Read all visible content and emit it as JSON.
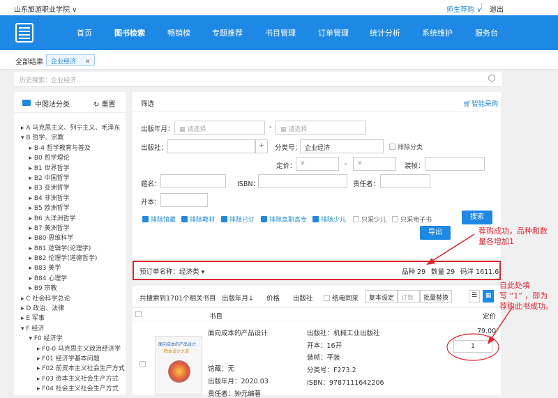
{
  "topbar": {
    "school": "山东旅游职业学院 ∨",
    "user": "师生荐购 ∨",
    "logout": "退出"
  },
  "nav": {
    "items": [
      "首页",
      "图书检索",
      "畅销榜",
      "专题推荐",
      "书目管理",
      "订单管理",
      "统计分析",
      "系统维护",
      "服务台"
    ],
    "active_index": 1
  },
  "breadcrumb": {
    "all": "全部结果 >",
    "tag": "企业经济",
    "tag_close": "✕"
  },
  "search": {
    "placeholder": "历史搜索：企业经济"
  },
  "sidebar": {
    "title": "中图法分类",
    "reset": "重置",
    "tree": [
      "▸ A 马克思主义、列宁主义、毛泽东",
      "▾ B 哲学、宗教",
      "    ▸ B-4 哲学教育与普及",
      "    ▸ B0 哲学理论",
      "    ▸ B1 世界哲学",
      "    ▸ B2 中国哲学",
      "    ▸ B3 亚洲哲学",
      "    ▸ B4 非洲哲学",
      "    ▸ B5 欧洲哲学",
      "    ▸ B6 大洋洲哲学",
      "    ▸ B7 美洲哲学",
      "    ▸ B80 思维科学",
      "    ▸ B81 逻辑学(论理学)",
      "    ▸ B82 伦理学(道德哲学)",
      "    ▸ B83 美学",
      "    ▸ B84 心理学",
      "    ▸ B9 宗教",
      "▸ C 社会科学总论",
      "▸ D 政治、法律",
      "▸ E 军事",
      "▾ F 经济",
      "    ▾ F0 经济学",
      "        ▸ F0-0 马克思主义政治经济学",
      "        ▸ F01 经济学基本问题",
      "        ▸ F02 前资本主义社会生产方式",
      "        ▸ F03 资本主义社会生产方式",
      "        ▸ F04 社会主义社会生产方式"
    ]
  },
  "filter": {
    "title": "筛选",
    "smart": "智能采购",
    "pub_date_label": "出版年月：",
    "date_placeholder": "请选择",
    "dash": "-",
    "publisher_label": "出版社：",
    "plus": "+",
    "classno_label": "分类号：",
    "classno_value": "企业经济",
    "exclude_class": "排除分类",
    "price_label": "定价：",
    "price_placeholder": "¥",
    "binding_label": "装帧：",
    "title_label": "题名：",
    "isbn_label": "ISBN：",
    "author_label": "责任者：",
    "format_label": "开本：",
    "checks": [
      {
        "label": "排除馆藏",
        "on": true
      },
      {
        "label": "排除教材",
        "on": true
      },
      {
        "label": "排除已订",
        "on": true
      },
      {
        "label": "排除高职高专",
        "on": true
      },
      {
        "label": "排除少儿",
        "on": true
      },
      {
        "label": "只采少儿",
        "on": false
      },
      {
        "label": "只采电子书",
        "on": false
      }
    ],
    "search_btn": "搜索",
    "export_btn": "导出"
  },
  "order_bar": {
    "name": "预订单名称：经济类",
    "kinds": "品种 29",
    "qty": "数量 29",
    "price": "码洋 1611.6"
  },
  "results": {
    "count_text": "共搜索到1701个相关书目",
    "sort_pub": "出版年月↓",
    "sort_price": "价格",
    "sort_publisher": "出版社",
    "same_pub": "纸电同采",
    "copies_setting": "复本设定",
    "order_placeholder": "订数",
    "batch_replace": "批量替换",
    "col_title": "书目",
    "col_price": "定价"
  },
  "book": {
    "title": "面向成本的产品设计",
    "holdings": "馆藏：无",
    "pub_date": "出版年月：2020.03",
    "author": "责任者：钟元编著",
    "publisher": "出版社：机械工业出版社",
    "format": "开本：16开",
    "binding": "装帧：平装",
    "classno": "分类号：F273.2",
    "isbn": "ISBN：9787111642206",
    "price": "79.00",
    "qty": "1",
    "cover_title": "面向成本的产品设计",
    "cover_sub": "降本设计之道"
  },
  "annotations": {
    "a1_line1": "荐购成功，品种和数",
    "a1_line2": "量各增加1",
    "a2_line1": "自此处填",
    "a2_line2": "写 “1” ，即为",
    "a2_line3": "荐购此书成功。"
  },
  "colors": {
    "nav": "#1e88e5",
    "annotation": "#e0262f",
    "link": "#1e88d9"
  }
}
